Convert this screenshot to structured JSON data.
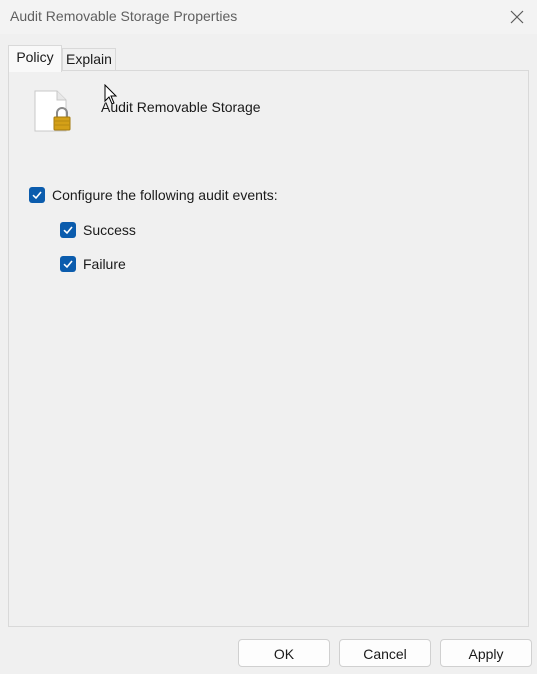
{
  "window": {
    "title": "Audit Removable Storage Properties",
    "close_icon": "close-icon"
  },
  "tabs": [
    {
      "label": "Policy",
      "active": true
    },
    {
      "label": "Explain",
      "active": false
    }
  ],
  "policy": {
    "icon": "document-lock-icon",
    "name": "Audit Removable Storage",
    "configure_label": "Configure the following audit events:",
    "configure_checked": true,
    "success_label": "Success",
    "success_checked": true,
    "failure_label": "Failure",
    "failure_checked": true
  },
  "buttons": {
    "ok": "OK",
    "cancel": "Cancel",
    "apply": "Apply"
  },
  "colors": {
    "accent": "#0b5cad",
    "lock": "#d4a017"
  }
}
